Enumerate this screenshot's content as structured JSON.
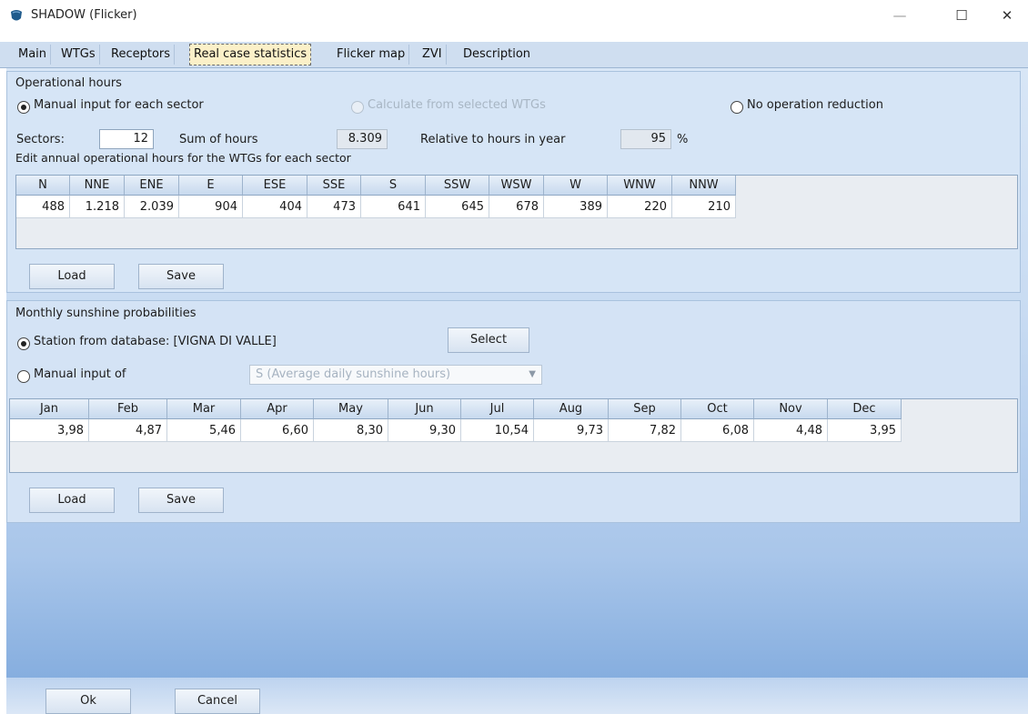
{
  "window": {
    "title": "SHADOW (Flicker)",
    "minimize_glyph": "—",
    "maximize_glyph": "☐",
    "close_glyph": "✕"
  },
  "tabs": [
    {
      "label": "Main"
    },
    {
      "label": "WTGs"
    },
    {
      "label": "Receptors"
    },
    {
      "label": "Real case statistics"
    },
    {
      "label": "Flicker map"
    },
    {
      "label": "ZVI"
    },
    {
      "label": "Description"
    }
  ],
  "operational": {
    "group_title": "Operational hours",
    "radio_manual": "Manual input for each sector",
    "radio_calculate": "Calculate from selected WTGs",
    "radio_no_reduction": "No operation reduction",
    "sectors_label": "Sectors:",
    "sectors_value": "12",
    "sum_label": "Sum of hours",
    "sum_value": "8.309",
    "relative_label": "Relative to hours in year",
    "relative_value": "95",
    "relative_unit": "%",
    "edit_label": "Edit annual operational hours for the WTGs for each sector",
    "columns": [
      "N",
      "NNE",
      "ENE",
      "E",
      "ESE",
      "SSE",
      "S",
      "SSW",
      "WSW",
      "W",
      "WNW",
      "NNW"
    ],
    "values": [
      "488",
      "1.218",
      "2.039",
      "904",
      "404",
      "473",
      "641",
      "645",
      "678",
      "389",
      "220",
      "210"
    ],
    "load_label": "Load",
    "save_label": "Save"
  },
  "sunshine": {
    "group_title": "Monthly sunshine probabilities",
    "radio_station": "Station from database: [VIGNA DI VALLE]",
    "select_label": "Select",
    "radio_manual": "Manual input of",
    "manual_option": "S (Average daily sunshine hours)",
    "columns": [
      "Jan",
      "Feb",
      "Mar",
      "Apr",
      "May",
      "Jun",
      "Jul",
      "Aug",
      "Sep",
      "Oct",
      "Nov",
      "Dec"
    ],
    "values": [
      "3,98",
      "4,87",
      "5,46",
      "6,60",
      "8,30",
      "9,30",
      "10,54",
      "9,73",
      "7,82",
      "6,08",
      "4,48",
      "3,95"
    ],
    "load_label": "Load",
    "save_label": "Save"
  },
  "footer": {
    "ok_label": "Ok",
    "cancel_label": "Cancel"
  },
  "colors": {
    "accent": "#1f5b8c",
    "active_tab": "#fbf0c8"
  }
}
